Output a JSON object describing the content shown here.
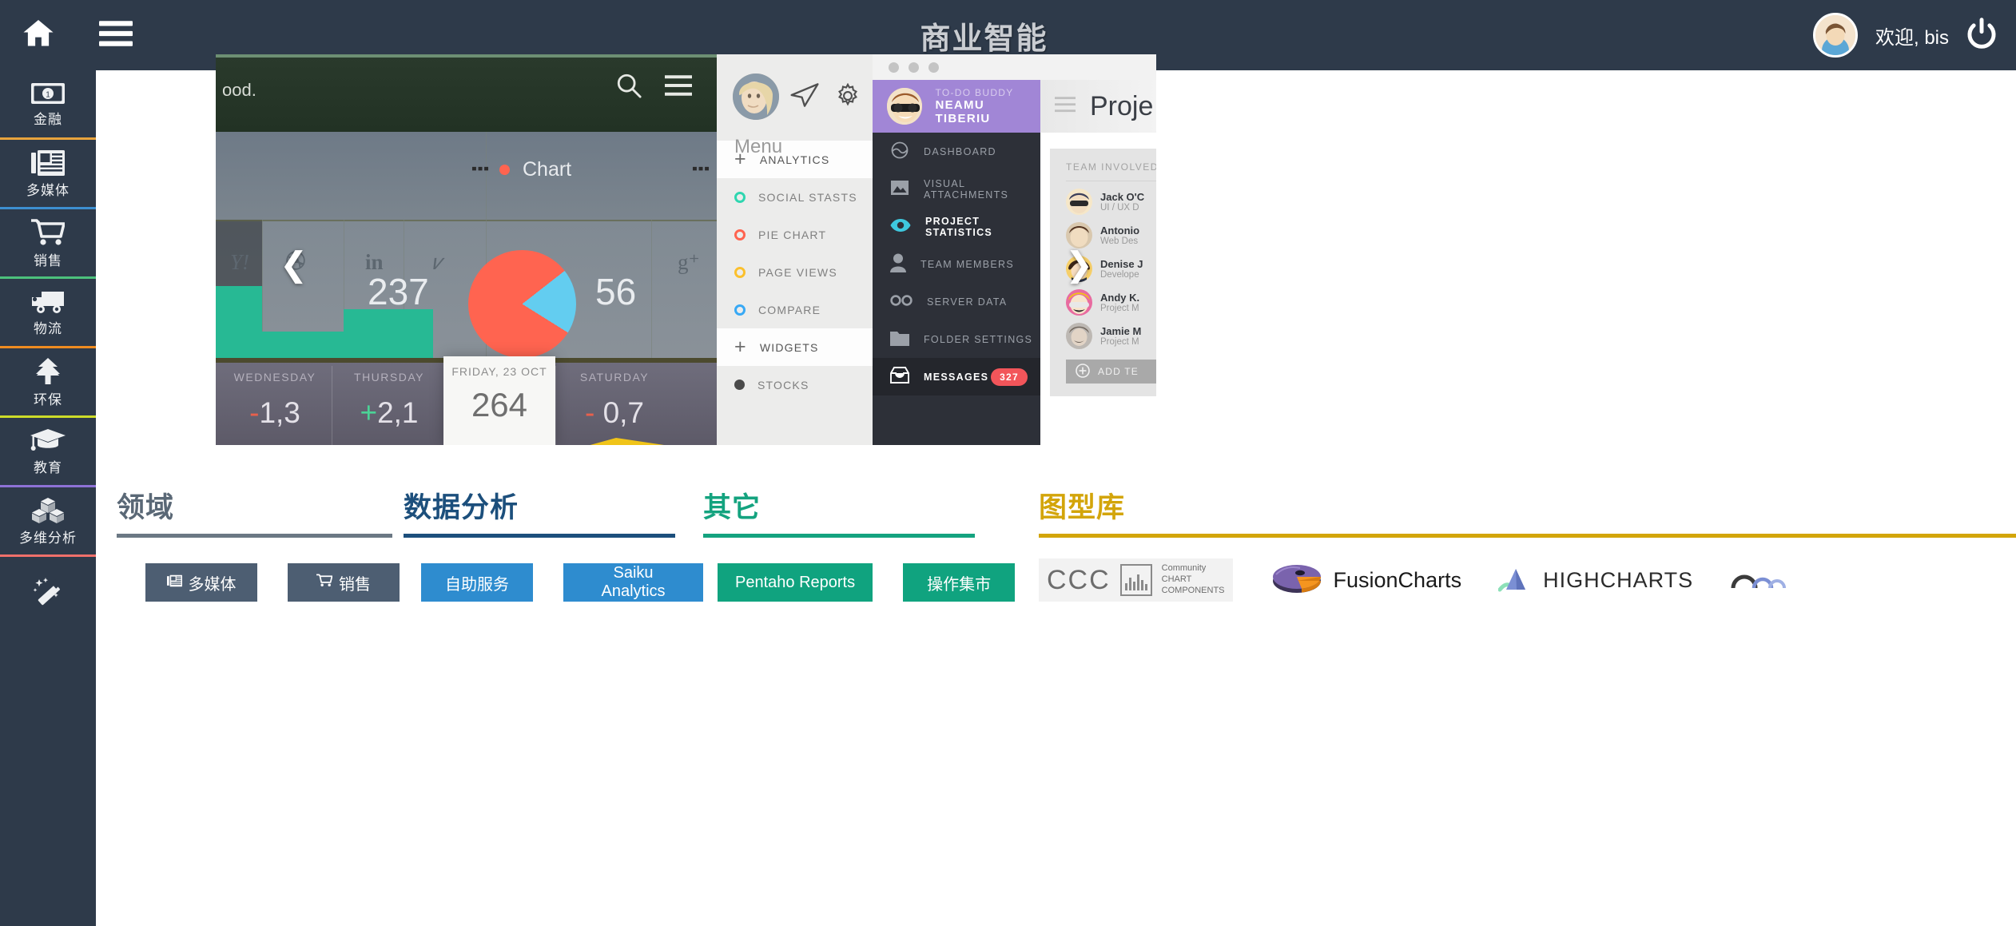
{
  "topbar": {
    "home_icon": "home-icon",
    "menu_icon": "hamburger-menu-icon",
    "title": "商业智能",
    "welcome": "欢迎, bis",
    "power_icon": "power-icon",
    "bg_color": "#2e3a4a"
  },
  "sidebar": {
    "items": [
      {
        "label": "金融",
        "icon": "money-bill-icon",
        "divider": "#e8a33d"
      },
      {
        "label": "多媒体",
        "icon": "newspaper-icon",
        "divider": "#3d8fd1"
      },
      {
        "label": "销售",
        "icon": "shopping-cart-icon",
        "divider": "#4cc17c"
      },
      {
        "label": "物流",
        "icon": "truck-icon",
        "divider": "#ef8b20"
      },
      {
        "label": "环保",
        "icon": "tree-icon",
        "divider": "#cddc29"
      },
      {
        "label": "教育",
        "icon": "graduation-cap-icon",
        "divider": "#8d72d6"
      },
      {
        "label": "多维分析",
        "icon": "cubes-icon",
        "divider": "#f0706b"
      },
      {
        "label": "",
        "icon": "magic-wand-icon",
        "divider": "transparent"
      }
    ]
  },
  "carousel": {
    "prev_arrow": "chevron-left-icon",
    "next_arrow": "chevron-right-icon",
    "dots": 3,
    "active_dot": 0,
    "slide": {
      "banner_text": "ood.",
      "search_icon": "search-icon",
      "menu_icon": "hamburger-menu-icon",
      "chart_label": "Chart",
      "social_icons": [
        "Y!",
        "dribbble",
        "in",
        "v",
        "g+"
      ],
      "pie": {
        "total_label": "237",
        "secondary_label": "56"
      },
      "days": [
        {
          "name": "WEDNESDAY",
          "sign": "-",
          "value": "1,3"
        },
        {
          "name": "THURSDAY",
          "sign": "+",
          "value": "2,1"
        },
        {
          "name": "SATURDAY",
          "sign": "-",
          "value": "0,7"
        }
      ],
      "active_day": {
        "name": "FRIDAY, 23 OCT",
        "value": "264"
      },
      "menu_panel": {
        "title": "Menu",
        "send_icon": "paper-plane-icon",
        "settings_icon": "gear-icon",
        "rows": [
          {
            "label": "ANALYTICS",
            "type": "header",
            "color": "#6d6d6d"
          },
          {
            "label": "SOCIAL STASTS",
            "type": "item",
            "color": "#2fd6b0"
          },
          {
            "label": "PIE CHART",
            "type": "item",
            "color": "#ff6450"
          },
          {
            "label": "PAGE VIEWS",
            "type": "item",
            "color": "#fbc02d"
          },
          {
            "label": "COMPARE",
            "type": "item",
            "color": "#38a9f5"
          },
          {
            "label": "WIDGETS",
            "type": "header",
            "color": "#6d6d6d"
          },
          {
            "label": "STOCKS",
            "type": "solid",
            "color": "#4a4a4a"
          }
        ]
      },
      "project_panel": {
        "user_role": "TO-DO BUDDY",
        "user_name": "NEAMU TIBERIU",
        "page_title": "Proje",
        "nav": [
          {
            "label": "DASHBOARD",
            "icon": "dashboard-icon",
            "active": false
          },
          {
            "label": "VISUAL ATTACHMENTS",
            "icon": "image-icon",
            "active": false
          },
          {
            "label": "PROJECT STATISTICS",
            "icon": "eye-icon",
            "active": true
          },
          {
            "label": "TEAM MEMBERS",
            "icon": "user-icon",
            "active": false
          },
          {
            "label": "SERVER DATA",
            "icon": "infinity-icon",
            "active": false
          },
          {
            "label": "FOLDER SETTINGS",
            "icon": "folder-icon",
            "active": false
          }
        ],
        "messages": {
          "label": "MESSAGES",
          "icon": "inbox-icon",
          "badge": "327"
        },
        "team": {
          "title": "TEAM INVOLVED",
          "members": [
            {
              "name": "Jack O'C",
              "role": "UI / UX D",
              "color": "#f2d9a8"
            },
            {
              "name": "Antonio",
              "role": "Web Des",
              "color": "#d8c0a4"
            },
            {
              "name": "Denise J",
              "role": "Develope",
              "color": "#f6cf6a"
            },
            {
              "name": "Andy K.",
              "role": "Project M",
              "color": "#f5b52a"
            },
            {
              "name": "Jamie M",
              "role": "Project M",
              "color": "#b8b2ad"
            }
          ],
          "add_button": {
            "label": "ADD TE",
            "icon": "plus-circle-icon"
          }
        }
      }
    }
  },
  "columns": [
    {
      "title": "领域",
      "title_color": "#5a6876",
      "rule_color": "#6b7884",
      "buttons": [
        {
          "label": "多媒体",
          "icon": "newspaper-icon",
          "color": "#4d5e72"
        },
        {
          "label": "销售",
          "icon": "shopping-cart-icon",
          "color": "#4d5e72"
        }
      ]
    },
    {
      "title": "数据分析",
      "title_color": "#1c4f7c",
      "rule_color": "#1c4f7c",
      "buttons": [
        {
          "label": "自助服务",
          "icon": "",
          "color": "#2e8ccf"
        },
        {
          "label": "Saiku Analytics",
          "icon": "",
          "color": "#2e8ccf"
        }
      ]
    },
    {
      "title": "其它",
      "title_color": "#14a37f",
      "rule_color": "#14a37f",
      "buttons": [
        {
          "label": "Pentaho Reports",
          "icon": "",
          "color": "#10a37f"
        },
        {
          "label": "操作集市",
          "icon": "",
          "color": "#10a37f"
        }
      ]
    },
    {
      "title": "图型库",
      "title_color": "#d3a50a",
      "rule_color": "#d3a50a",
      "logos": [
        {
          "name": "ccc-logo",
          "text": "CCC",
          "caption": "Community\nCHART\nCOMPONENTS"
        },
        {
          "name": "fusioncharts-logo",
          "text": "FusionCharts",
          "caption": ""
        },
        {
          "name": "highcharts-logo",
          "text": "HIGHCHARTS",
          "caption": ""
        },
        {
          "name": "other-chart-logo",
          "text": "",
          "caption": ""
        }
      ]
    }
  ]
}
